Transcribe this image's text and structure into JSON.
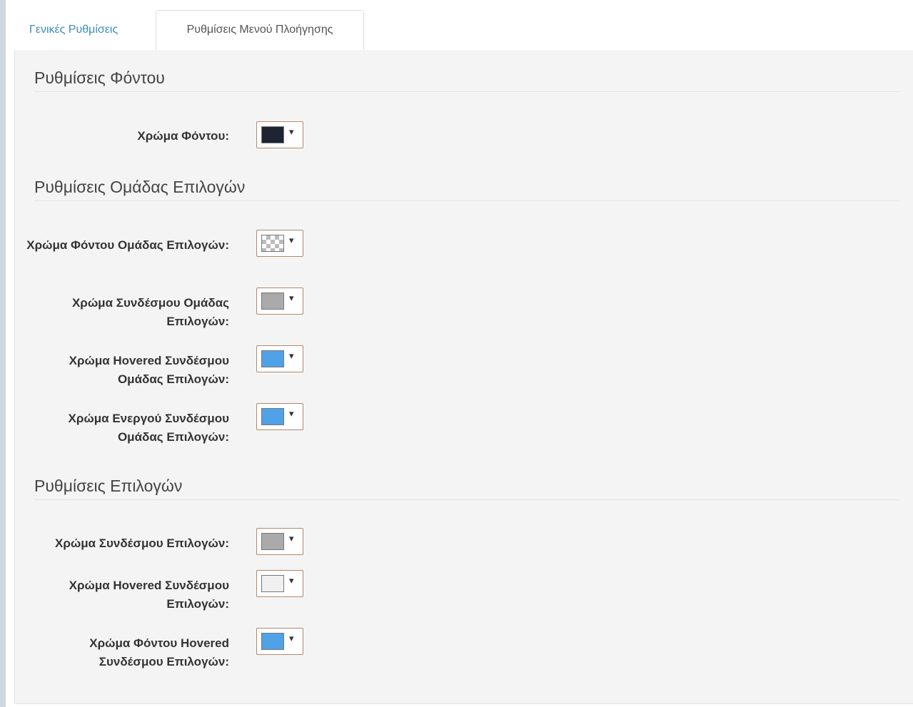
{
  "tabs": [
    {
      "label": "Γενικές Ρυθμίσεις",
      "active": false
    },
    {
      "label": "Ρυθμίσεις Μενού Πλοήγησης",
      "active": true
    }
  ],
  "sections": [
    {
      "title": "Ρυθμίσεις Φόντου",
      "fields": [
        {
          "label": "Χρώμα Φόντου:",
          "color": "#1e2433",
          "transparent": false
        }
      ]
    },
    {
      "title": "Ρυθμίσεις Ομάδας Επιλογών",
      "fields": [
        {
          "label": "Χρώμα Φόντου Ομάδας Επιλογών:",
          "color": "transparent",
          "transparent": true
        },
        {
          "label": "Χρώμα Συνδέσμου Ομάδας Επιλογών:",
          "color": "#aaaaaa",
          "transparent": false
        },
        {
          "label": "Χρώμα Hovered Συνδέσμου Ομάδας Επιλογών:",
          "color": "#4fa1e8",
          "transparent": false
        },
        {
          "label": "Χρώμα Ενεργού Συνδέσμου Ομάδας Επιλογών:",
          "color": "#4fa1e8",
          "transparent": false
        }
      ]
    },
    {
      "title": "Ρυθμίσεις Επιλογών",
      "fields": [
        {
          "label": "Χρώμα Συνδέσμου Επιλογών:",
          "color": "#aaaaaa",
          "transparent": false
        },
        {
          "label": "Χρώμα Hovered Συνδέσμου Επιλογών:",
          "color": "#f0f0f0",
          "transparent": false
        },
        {
          "label": "Χρώμα Φόντου Hovered Συνδέσμου Επιλογών:",
          "color": "#4fa1e8",
          "transparent": false
        }
      ]
    }
  ],
  "dropdown_caret": "▾"
}
